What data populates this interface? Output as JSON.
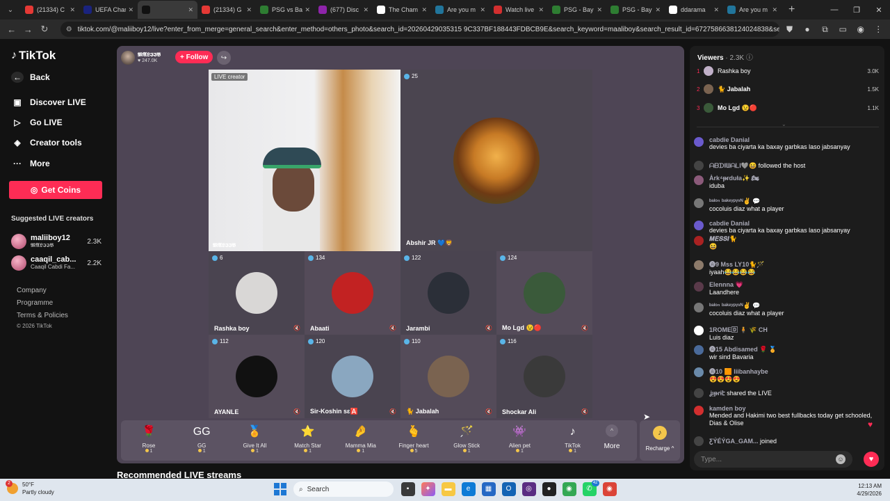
{
  "browser": {
    "tabs": [
      {
        "title": "(21334) C",
        "color": "#e53935"
      },
      {
        "title": "UEFA Chan",
        "color": "#1a237e"
      },
      {
        "title": "",
        "color": "#111111",
        "active": true
      },
      {
        "title": "(21334) G",
        "color": "#e53935"
      },
      {
        "title": "PSG vs Bay",
        "color": "#2e7d32"
      },
      {
        "title": "(677) Disc",
        "color": "#8e24aa"
      },
      {
        "title": "The Cham",
        "color": "#ffffff"
      },
      {
        "title": "Are you m",
        "color": "#21759b"
      },
      {
        "title": "Watch live",
        "color": "#d32f2f"
      },
      {
        "title": "PSG - Bay",
        "color": "#2e7d32"
      },
      {
        "title": "PSG - Bay",
        "color": "#2e7d32"
      },
      {
        "title": "ddarama",
        "color": "#ffffff"
      },
      {
        "title": "Are you m",
        "color": "#21759b"
      }
    ],
    "url": "tiktok.com/@maliiboy12/live?enter_from_merge=general_search&enter_method=others_photo&search_id=20260429035315 9C337BF188443FDBCB9E&search_keyword=maaliboy&search_result_id=6727586638124024838&search_type=general"
  },
  "sidebar": {
    "logo": "TikTok",
    "nav": [
      {
        "label": "Back"
      },
      {
        "label": "Discover LIVE"
      },
      {
        "label": "Go LIVE"
      },
      {
        "label": "Creator tools"
      },
      {
        "label": "More"
      }
    ],
    "coins_button": "Get Coins",
    "suggested_title": "Suggested LIVE creators",
    "suggested": [
      {
        "name": "maliiboy12",
        "sub": "𝕸𝕬𝕷𝕴𝕴𝕭",
        "count": "2.3K"
      },
      {
        "name": "caaqil_cab...",
        "sub": "Caaqil Cabdi Fa...",
        "count": "2.2K"
      }
    ],
    "footer": [
      "Company",
      "Programme",
      "Terms & Policies"
    ],
    "copyright": "© 2026 TikTok"
  },
  "stage": {
    "host_name": "𝕸𝕬𝕷𝕴𝕴𝕭",
    "host_likes": "247.0K",
    "follow_label": "+ Follow",
    "live_label": "LIVE creator",
    "host_caption": "𝕸𝕬𝕷𝕴𝕴𝕭",
    "guest_main": {
      "score": "25",
      "name": "Abshir JR 💙🦁"
    },
    "guests": [
      {
        "score": "6",
        "name": "Rashka boy",
        "color": "#d9d7d6"
      },
      {
        "score": "134",
        "name": "Abaati",
        "color": "#c22222"
      },
      {
        "score": "122",
        "name": "Jarambi",
        "color": "#2b2f38"
      },
      {
        "score": "124",
        "name": "Mo Lgd 😉🔴",
        "color": "#3a5a3a"
      },
      {
        "score": "112",
        "name": "AYANLE",
        "color": "#111111"
      },
      {
        "score": "120",
        "name": "Sir-Koshin sɛ🅰️",
        "color": "#8aa7c0"
      },
      {
        "score": "110",
        "name": "🐈 Jabalah",
        "color": "#7a6350"
      },
      {
        "score": "116",
        "name": "Shockar Ali",
        "color": "#3a3a3a"
      }
    ],
    "gifts": [
      {
        "name": "Rose",
        "price": "1",
        "icon": "🌹"
      },
      {
        "name": "GG",
        "price": "1",
        "icon": "GG"
      },
      {
        "name": "Give It All",
        "price": "1",
        "icon": "🏅"
      },
      {
        "name": "Match Star",
        "price": "1",
        "icon": "⭐"
      },
      {
        "name": "Mamma Mia",
        "price": "1",
        "icon": "🤌"
      },
      {
        "name": "Finger heart",
        "price": "5",
        "icon": "🫰"
      },
      {
        "name": "Glow Stick",
        "price": "1",
        "icon": "🪄"
      },
      {
        "name": "Alien pet",
        "price": "1",
        "icon": "👾"
      },
      {
        "name": "TikTok",
        "price": "1",
        "icon": "♪"
      }
    ],
    "more_label": "More",
    "recharge_label": "Recharge ^"
  },
  "recommended_title": "Recommended LIVE streams",
  "viewers": {
    "title": "Viewers",
    "count": "· 2.3K",
    "top": [
      {
        "rank": "1",
        "name": "Rashka boy",
        "score": "3.0K"
      },
      {
        "rank": "2",
        "name": "🐈 Jabalah",
        "score": "1.5K"
      },
      {
        "rank": "3",
        "name": "Mo Lgd 😉🔴",
        "score": "1.1K"
      }
    ]
  },
  "chat": [
    {
      "user": "cabdie Danial",
      "text": "devies ba ciyarta ka baxay garbkas laso jabsanyay",
      "color": "#6a5acd"
    },
    {
      "user": "ᗩᗷᗪIᗯᗩᒪI🩶😆",
      "text": "followed the host",
      "inline": true,
      "color": "#444444"
    },
    {
      "user": "Ȧrk⁴ᵽᵲduła✨ 🏍",
      "text": "iduba",
      "color": "#8b5a7a"
    },
    {
      "user": "ᵇᵃˡᵒⁿ ᵇᵃᵏᵉʸᵖᵞᵛᴺ✌️ 💬",
      "text": "cocoluis diaz what a player",
      "color": "#777777"
    },
    {
      "user": "cabdie Danial",
      "text": "devies ba ciyarta ka baxay garbkas laso jabsanyay",
      "color": "#6a5acd"
    },
    {
      "user": "𝑴𝑬𝑺𝑺𝑰🐈",
      "text": "😆",
      "color": "#aa2222"
    },
    {
      "user": "🅐9 Mss LY10🐈🪄",
      "text": "iyaah😂😂😂😂",
      "color": "#8d7b6b"
    },
    {
      "user": "Elennna 💗",
      "text": "Laandhere",
      "color": "#5a3a4a"
    },
    {
      "user": "ᵇᵃˡᵒⁿ ᵇᵃᵏᵉʸᵖᵞᵛᴺ✌️ 💬",
      "text": "cocoluis diaz what a player",
      "color": "#777777"
    },
    {
      "user": "1ROME🄳 🧍 🌾 CH",
      "text": "Luis diaz",
      "color": "#ffffff"
    },
    {
      "user": "🅐15 Abdisamed 🌹 🏅",
      "text": "wir sind Bavaria",
      "color": "#4a6a9a"
    },
    {
      "user": "🅐10 🟧 liibanhaybe",
      "text": "😍😍😍😍",
      "color": "#6a8aaa"
    },
    {
      "user": "ʝᴉᵽɾɨէ",
      "text": "shared the LIVE",
      "inline": true,
      "color": "#444444"
    },
    {
      "user": "kamden boy",
      "text": "Mended and Hakimi two best fullbacks today get schooled, Dias & Olise",
      "color": "#d32f2f"
    },
    {
      "user": "ƸÝÉÝGA_GAM...",
      "text": "joined",
      "inline": true,
      "color": "#444444"
    }
  ],
  "chat_input_placeholder": "Type...",
  "taskbar": {
    "temp": "50°F",
    "weather": "Partly cloudy",
    "weather_badge": "2",
    "search": "Search",
    "time": "12:13 AM",
    "date": "4/29/2026",
    "badge_count": "42"
  }
}
